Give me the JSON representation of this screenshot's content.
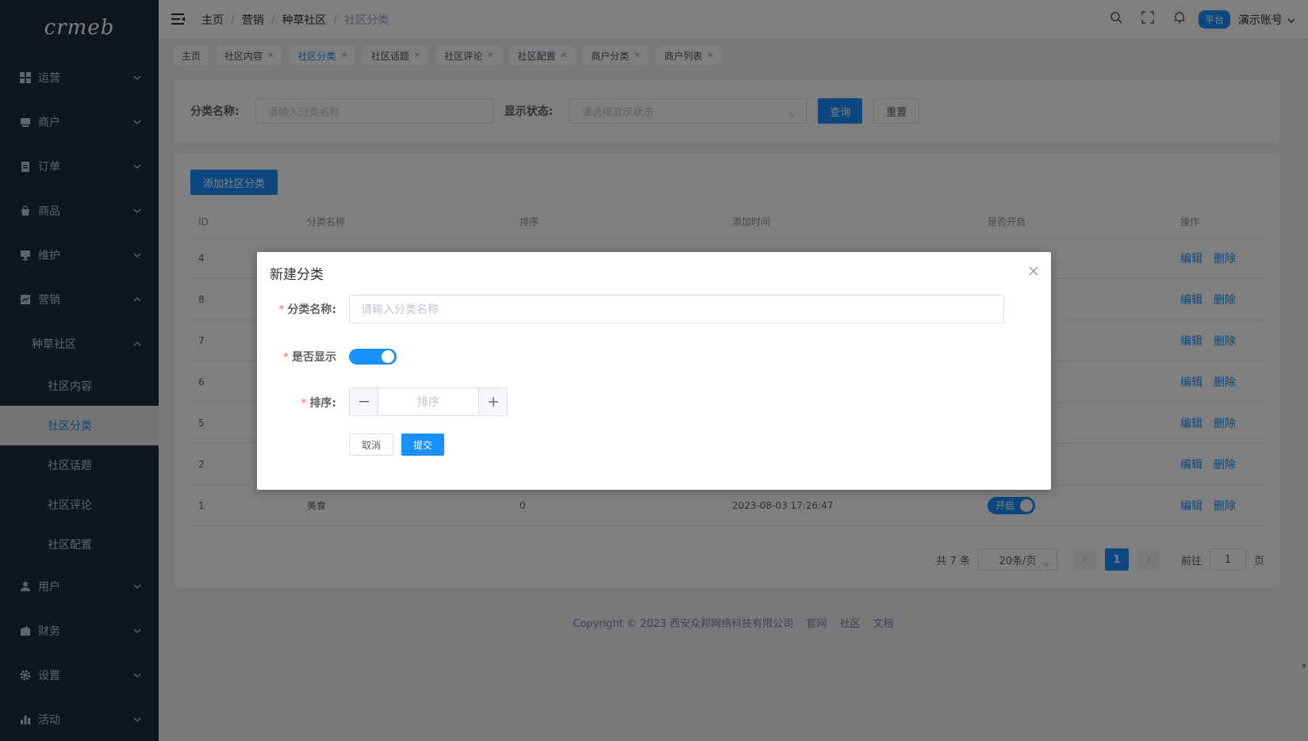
{
  "app": {
    "logo": "crmeb"
  },
  "sidebar": {
    "items": [
      {
        "label": "运营",
        "icon": "grid-icon",
        "expanded": false
      },
      {
        "label": "商户",
        "icon": "store-icon",
        "expanded": false
      },
      {
        "label": "订单",
        "icon": "clipboard-icon",
        "expanded": false
      },
      {
        "label": "商品",
        "icon": "bag-icon",
        "expanded": false
      },
      {
        "label": "维护",
        "icon": "monitor-icon",
        "expanded": false
      },
      {
        "label": "营销",
        "icon": "chart-icon",
        "expanded": true
      }
    ],
    "submenu_label": "种草社区",
    "submenu_items": [
      {
        "label": "社区内容",
        "active": false
      },
      {
        "label": "社区分类",
        "active": true
      },
      {
        "label": "社区话题",
        "active": false
      },
      {
        "label": "社区评论",
        "active": false
      },
      {
        "label": "社区配置",
        "active": false
      }
    ],
    "bottom_items": [
      {
        "label": "用户",
        "icon": "user-icon"
      },
      {
        "label": "财务",
        "icon": "wallet-icon"
      },
      {
        "label": "设置",
        "icon": "gear-icon"
      },
      {
        "label": "活动",
        "icon": "bar-chart-icon"
      }
    ]
  },
  "header": {
    "breadcrumb": [
      "主页",
      "营销",
      "种草社区",
      "社区分类"
    ],
    "platform_badge": "平台",
    "account": "演示账号"
  },
  "tags": [
    {
      "label": "主页",
      "closable": false,
      "active": false
    },
    {
      "label": "社区内容",
      "closable": true,
      "active": false
    },
    {
      "label": "社区分类",
      "closable": true,
      "active": true
    },
    {
      "label": "社区话题",
      "closable": true,
      "active": false
    },
    {
      "label": "社区评论",
      "closable": true,
      "active": false
    },
    {
      "label": "社区配置",
      "closable": true,
      "active": false
    },
    {
      "label": "商户分类",
      "closable": true,
      "active": false
    },
    {
      "label": "商户列表",
      "closable": true,
      "active": false
    }
  ],
  "search": {
    "name_label": "分类名称:",
    "name_placeholder": "请输入分类名称",
    "status_label": "显示状态:",
    "status_placeholder": "请选择显示状态",
    "query_button": "查询",
    "reset_button": "重置"
  },
  "table": {
    "add_button": "添加社区分类",
    "columns": [
      "ID",
      "分类名称",
      "排序",
      "添加时间",
      "是否开启",
      "操作"
    ],
    "rows": [
      {
        "id": "4"
      },
      {
        "id": "8"
      },
      {
        "id": "7"
      },
      {
        "id": "6"
      },
      {
        "id": "5"
      },
      {
        "id": "2"
      },
      {
        "id": "1",
        "name": "美食",
        "sort": "0",
        "time": "2023-08-03 17:26:47",
        "switch_label": "开启"
      }
    ],
    "edit_label": "编辑",
    "delete_label": "删除"
  },
  "pagination": {
    "total": "共 7 条",
    "page_size": "20条/页",
    "current_page": "1",
    "goto_label": "前往",
    "goto_value": "1",
    "page_suffix": "页"
  },
  "footer": {
    "copyright": "Copyright © 2023 西安众邦网络科技有限公司",
    "links": [
      "官网",
      "社区",
      "文档"
    ]
  },
  "dialog": {
    "title": "新建分类",
    "name_label": "分类名称:",
    "name_placeholder": "请输入分类名称",
    "show_label": "是否显示",
    "show_enabled": true,
    "sort_label": "排序:",
    "sort_placeholder": "排序",
    "cancel_button": "取消",
    "submit_button": "提交"
  }
}
